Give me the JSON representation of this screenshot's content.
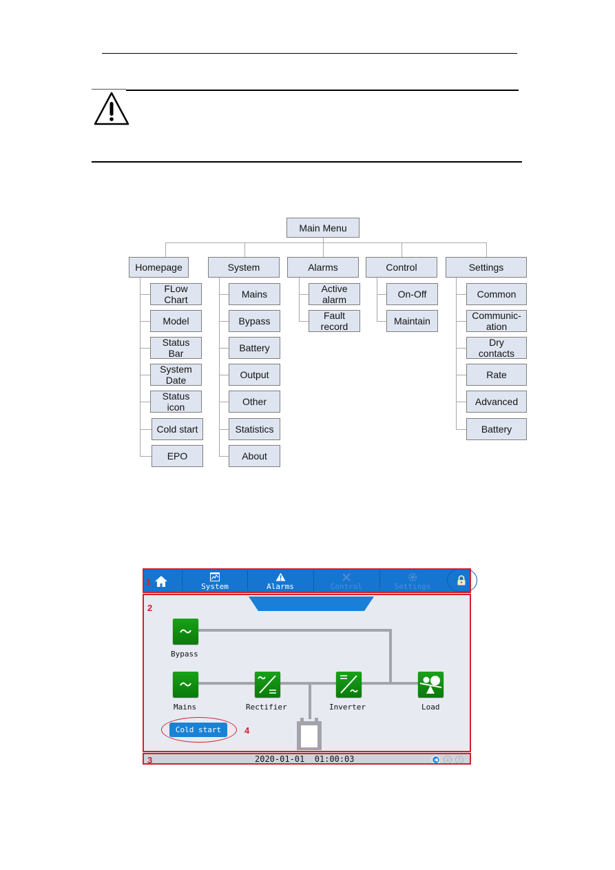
{
  "page": {
    "warning_icon": "warning-triangle-icon"
  },
  "menu_tree": {
    "root": "Main Menu",
    "branches": [
      {
        "label": "Homepage",
        "children": [
          "FLow\nChart",
          "Model",
          "Status\nBar",
          "System\nDate",
          "Status\nicon",
          "Cold start",
          "EPO"
        ]
      },
      {
        "label": "System",
        "children": [
          "Mains",
          "Bypass",
          "Battery",
          "Output",
          "Other",
          "Statistics",
          "About"
        ]
      },
      {
        "label": "Alarms",
        "children": [
          "Active\nalarm",
          "Fault\nrecord"
        ]
      },
      {
        "label": "Control",
        "children": [
          "On-Off",
          "Maintain"
        ]
      },
      {
        "label": "Settings",
        "children": [
          "Common",
          "Communic-\nation",
          "Dry\ncontacts",
          "Rate",
          "Advanced",
          "Battery"
        ]
      }
    ]
  },
  "ui_screen": {
    "nav": {
      "home_icon": "home-icon",
      "tabs": [
        {
          "label": "System",
          "icon": "chart-icon",
          "enabled": true
        },
        {
          "label": "Alarms",
          "icon": "warning-icon",
          "enabled": true
        },
        {
          "label": "Control",
          "icon": "tools-icon",
          "enabled": false
        },
        {
          "label": "Settings",
          "icon": "gear-icon",
          "enabled": false
        }
      ],
      "lock_icon": "lock-icon"
    },
    "flow": {
      "bypass": "Bypass",
      "mains": "Mains",
      "rectifier": "Rectifier",
      "inverter": "Inverter",
      "load": "Load",
      "battery_icon": "battery-icon"
    },
    "cold_start_button": "Cold start",
    "status_bar": {
      "datetime": "2020-01-01  01:00:03",
      "icons": [
        "buzzer-icon",
        "alarm-icon",
        "maintenance-icon"
      ]
    },
    "annotations": [
      "1",
      "2",
      "3",
      "4"
    ],
    "colors": {
      "nav_blue": "#1476d0",
      "button_blue": "#1a82d4",
      "node_green": "#13931a",
      "annotation_red": "#d02030"
    }
  }
}
